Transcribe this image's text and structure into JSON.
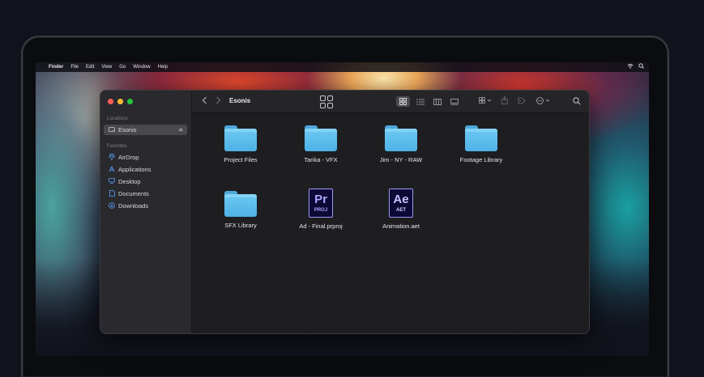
{
  "menubar": {
    "apple": "",
    "items": [
      "Finder",
      "File",
      "Edit",
      "View",
      "Go",
      "Window",
      "Help"
    ]
  },
  "window": {
    "title": "Esonis",
    "sidebar": {
      "locations_label": "Locations",
      "location_item": "Esonis",
      "favorites_label": "Favorites",
      "favorites": [
        {
          "label": "AirDrop",
          "icon": "airdrop-icon"
        },
        {
          "label": "Applications",
          "icon": "applications-icon"
        },
        {
          "label": "Desktop",
          "icon": "desktop-icon"
        },
        {
          "label": "Documents",
          "icon": "documents-icon"
        },
        {
          "label": "Downloads",
          "icon": "downloads-icon"
        }
      ]
    },
    "files": [
      {
        "name": "Project Files",
        "type": "folder"
      },
      {
        "name": "Tarika - VFX",
        "type": "folder"
      },
      {
        "name": "Jim - NY - RAW",
        "type": "folder"
      },
      {
        "name": "Footage Library",
        "type": "folder"
      },
      {
        "name": "SFX Library",
        "type": "folder"
      },
      {
        "name": "Ad - Final.prproj",
        "type": "premiere",
        "badge": "Pr",
        "sub": "PROJ"
      },
      {
        "name": "Animation.aet",
        "type": "aftereffects",
        "badge": "Ae",
        "sub": "AET"
      }
    ]
  },
  "colors": {
    "folder": "#5cbde9",
    "traffic_red": "#ff5f57",
    "traffic_yellow": "#febc2e",
    "traffic_green": "#28c840",
    "accent_blue": "#5aa2ff"
  }
}
